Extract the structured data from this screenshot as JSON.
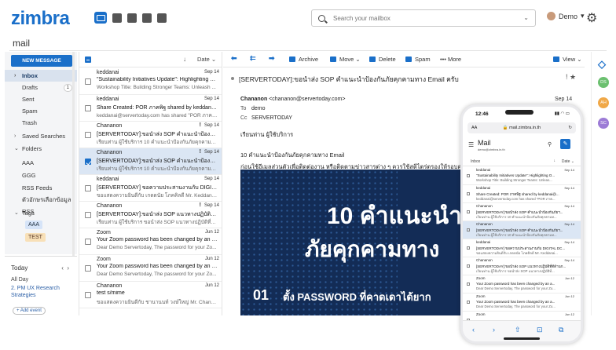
{
  "app": {
    "logo": "zimbra"
  },
  "page_title": "mail",
  "search": {
    "placeholder": "Search your mailbox"
  },
  "user": {
    "name": "Demo"
  },
  "folders": {
    "new_message": "NEW MESSAGE",
    "items": [
      {
        "label": "Inbox"
      },
      {
        "label": "Drafts",
        "count": "1"
      },
      {
        "label": "Sent"
      },
      {
        "label": "Spam"
      },
      {
        "label": "Trash"
      },
      {
        "label": "Saved Searches"
      },
      {
        "label": "Folders"
      },
      {
        "label": "AAA"
      },
      {
        "label": "GGG"
      },
      {
        "label": "RSS Feeds"
      },
      {
        "label": "ตัวอักษรเลือกข้อมูล RSS"
      },
      {
        "label": "Tags"
      }
    ],
    "tags": [
      "AAA",
      "TEST"
    ]
  },
  "calendar": {
    "today": "Today",
    "all_day": "All Day",
    "event": "2. PM UX Research Strategies",
    "add_event": "+ Add event"
  },
  "list": {
    "sort": "Date",
    "messages": [
      {
        "from": "keddanai",
        "date": "Sep 14",
        "subject": "\"Sustainability Initiatives Update\": Highlighting O...",
        "preview": "Workshop Title: Building Stronger Teams: Unleash ..."
      },
      {
        "from": "keddanai",
        "date": "Sep 14",
        "subject": "Share Created: POR ภาคพิฐ shared by keddanai@...",
        "preview": "keddanai@servertoday.com has shared \"POR ภาคพิ..."
      },
      {
        "from": "Chananon",
        "date": "Sep 14",
        "flags": "!",
        "subject": "[SERVERTODAY]:ขอนำส่ง SOP คำแนะนำป้องกันภัย...",
        "preview": "เรียนท่าน ผู้ใช้บริการ 10 คำแนะนำป้องกันภัยคุกคามทาง..."
      },
      {
        "from": "Chananon",
        "date": "Sep 14",
        "flags": "!",
        "selected": true,
        "subject": "[SERVERTODAY]:ขอนำส่ง SOP คำแนะนำป้องกันภัย...",
        "preview": "เรียนท่าน ผู้ใช้บริการ 10 คำแนะนำป้องกันภัยคุกคามทาง..."
      },
      {
        "from": "keddanai",
        "date": "Sep 14",
        "subject": "[SERVERTODAY] ขอความประสานงานกับ DIGITAL...",
        "preview": "ขอแสดงความยินดีกับ เกดดนัย โภคคิลดี Mr. Keddanai ..."
      },
      {
        "from": "Chananon",
        "date": "Sep 14",
        "flags": "!",
        "subject": "[SERVERTODAY]:ขอนำส่ง SOP แนวทางปฏิบัติที่ดีด้านการ...",
        "preview": "เรียนท่าน ผู้ใช้บริการ ขอนำส่ง SOP แนวทางปฏิบัติที่ดีด้..."
      },
      {
        "from": "Zoom",
        "date": "Jun 12",
        "subject": "Your Zoom password has been changed by an a...",
        "preview": "Dear Demo Servertoday, The password for your Zo..."
      },
      {
        "from": "Zoom",
        "date": "Jun 12",
        "subject": "Your Zoom password has been changed by an a...",
        "preview": "Dear Demo Servertoday, The password for your Zo..."
      },
      {
        "from": "Chananon",
        "date": "Jun 12",
        "subject": "test s/mime",
        "preview": "ขอแสดงความยินดีกับ ชานานนท์ วงษ์ใหญ่ Mr. Chananon..."
      }
    ]
  },
  "toolbar": {
    "archive": "Archive",
    "move": "Move",
    "delete": "Delete",
    "spam": "Spam",
    "more": "More",
    "view": "View"
  },
  "reading": {
    "subject": "[SERVERTODAY]:ขอนำส่ง SOP คำแนะนำป้องกันภัยคุกคามทาง Email ครับ",
    "from_name": "Chananon",
    "from_email": "<chananon@servertoday.com>",
    "to_label": "To",
    "to": "demo",
    "cc_label": "Cc",
    "cc": "SERVERTODAY",
    "date": "Sep 14",
    "greeting": "เรียนท่าน ผู้ใช้บริการ",
    "line1": "10 คำแนะนำป้องกันภัยคุกคามทาง Email",
    "line2": "ก่อนใช้อีเมลส่วนตัวเพื่อติดต่องาน หรือติดตามข่าวสารต่าง ๆ ควรใช้สติไตร่ตรองให้รอบคอบ",
    "banner_line1": "10 คำแนะนำ",
    "banner_line2": "ภัยคุกคามทาง",
    "banner_num": "01",
    "banner_tip": "ตั้ง PASSWORD ที่คาดเดาได้ยาก"
  },
  "rail": [
    "DS",
    "AH",
    "SC"
  ],
  "phone": {
    "time": "12:46",
    "url": "mail.zimbra.in.th",
    "aa": "AA",
    "title": "Mail",
    "account": "demo@zimbra.in.th",
    "inbox": "Inbox",
    "sort": "Date",
    "messages": [
      {
        "from": "keddanai",
        "date": "Sep 14",
        "subject": "\"Sustainability Initiatives Update\": Highlighting O...",
        "preview": "Workshop Title: Building Stronger Teams: Unleas..."
      },
      {
        "from": "keddanai",
        "date": "Sep 14",
        "subject": "Share Created: POR ภาคพิฐ shared by keddanai@...",
        "preview": "keddanai@servertoday.com has shared \"POR ภาค..."
      },
      {
        "from": "Chananon",
        "date": "Sep 14",
        "subject": "[SERVERTODAY]:ขอนำส่ง SOP คำแนะนำป้องกันภัยฯ...",
        "preview": "เรียนท่าน ผู้ใช้บริการ 10 คำแนะนำป้องกันภัยคุกคามท..."
      },
      {
        "from": "Chananon",
        "date": "Sep 14",
        "subject": "[SERVERTODAY]:ขอนำส่ง SOP คำแนะนำป้องกันภัยฯ...",
        "preview": "เรียนท่าน ผู้ใช้บริการ 10 คำแนะนำป้องกันภัยคุกคามท..."
      },
      {
        "from": "keddanai",
        "date": "Sep 14",
        "subject": "[SERVERTODAY] ขอความประสานงานกับ DIGITAL DC...",
        "preview": "ขอแสดงความยินดีกับ เกดดนัย โภคคิลดี Mr. Keddanai..."
      },
      {
        "from": "Chananon",
        "date": "Sep 14",
        "subject": "[SERVERTODAY]:ขอนำส่ง SOP แนวทางปฏิบัติที่ดีด้านก...",
        "preview": "เรียนท่าน ผู้ใช้บริการ ขอนำส่ง SOP แนวทางปฏิบัติที่..."
      },
      {
        "from": "Zoom",
        "date": "Jun 12",
        "subject": "Your Zoom password has been changed by an a...",
        "preview": "Dear Demo Servertoday, The password for your Zo..."
      },
      {
        "from": "Zoom",
        "date": "Jun 12",
        "subject": "Your Zoom password has been changed by an a...",
        "preview": "Dear Demo Servertoday, The password for your Zo..."
      },
      {
        "from": "Zoom",
        "date": "Jun 12",
        "subject": "",
        "preview": ""
      }
    ]
  }
}
